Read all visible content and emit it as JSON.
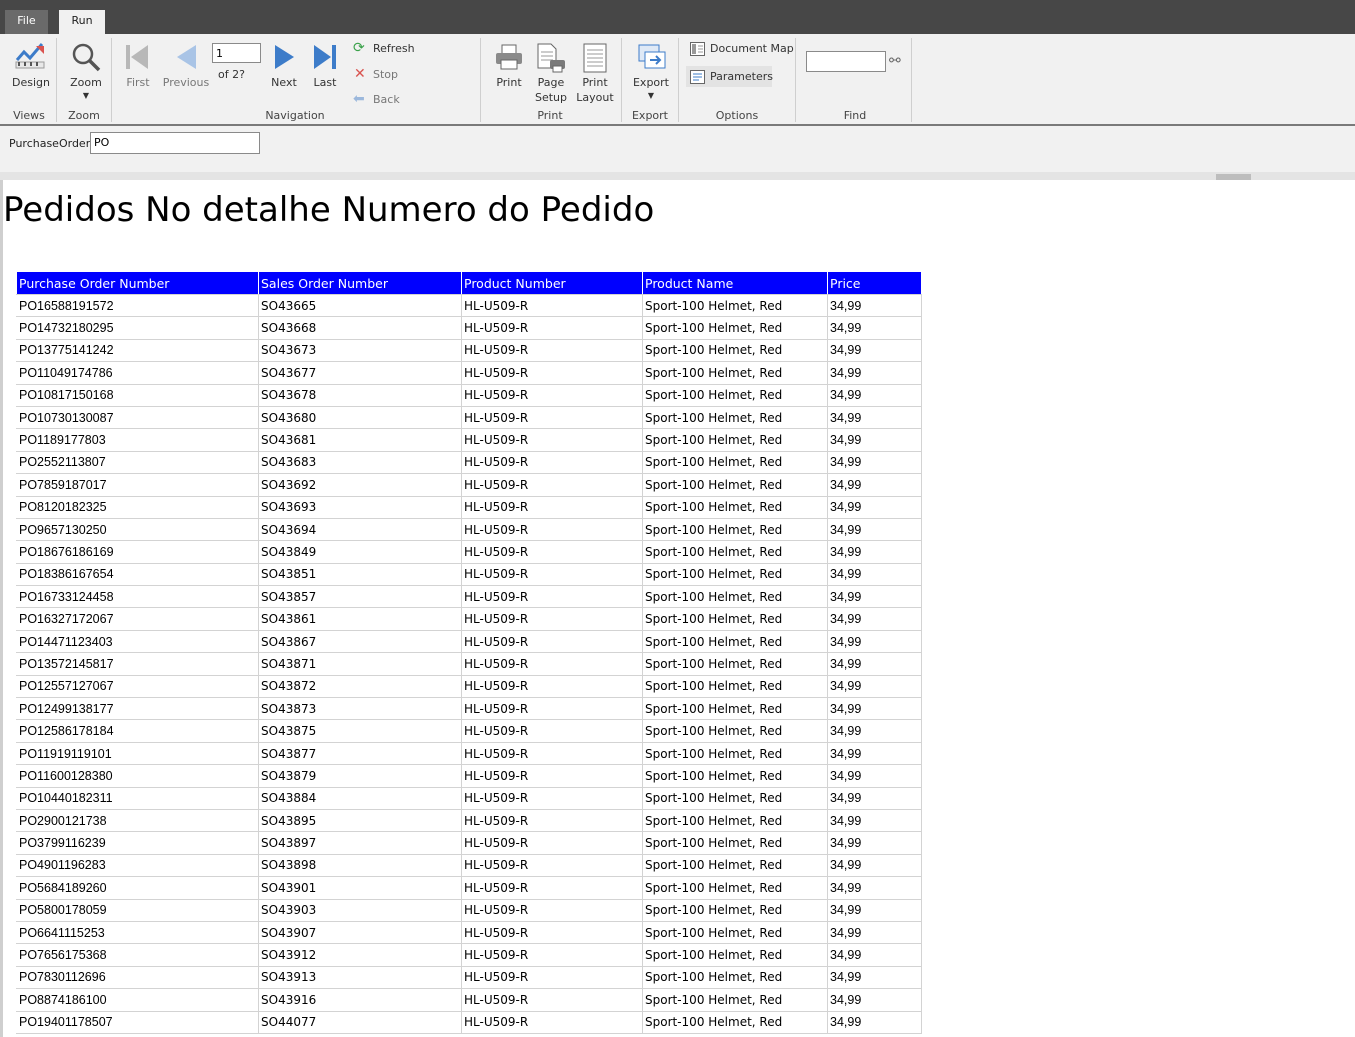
{
  "tabs": {
    "file": "File",
    "run": "Run"
  },
  "ribbon": {
    "views": {
      "design": "Design",
      "group": "Views"
    },
    "zoom": {
      "zoom": "Zoom",
      "group": "Zoom"
    },
    "navigation": {
      "first": "First",
      "previous": "Previous",
      "page_value": "1",
      "of_text": "of  2?",
      "next": "Next",
      "last": "Last",
      "refresh": "Refresh",
      "stop": "Stop",
      "back": "Back",
      "group": "Navigation"
    },
    "print": {
      "print": "Print",
      "page_setup_1": "Page",
      "page_setup_2": "Setup",
      "print_layout_1": "Print",
      "print_layout_2": "Layout",
      "group": "Print"
    },
    "export": {
      "export": "Export",
      "group": "Export"
    },
    "options": {
      "document_map": "Document Map",
      "parameters": "Parameters",
      "group": "Options"
    },
    "find": {
      "value": "",
      "group": "Find"
    }
  },
  "parameters": {
    "label": "PurchaseOrder",
    "value": "PO"
  },
  "report": {
    "title": "Pedidos No detalhe Numero do Pedido",
    "columns": [
      "Purchase Order Number",
      "Sales Order Number",
      "Product Number",
      "Product Name",
      "Price"
    ],
    "rows": [
      [
        "PO16588191572",
        "SO43665",
        "HL-U509-R",
        "Sport-100 Helmet, Red",
        "34,99"
      ],
      [
        "PO14732180295",
        "SO43668",
        "HL-U509-R",
        "Sport-100 Helmet, Red",
        "34,99"
      ],
      [
        "PO13775141242",
        "SO43673",
        "HL-U509-R",
        "Sport-100 Helmet, Red",
        "34,99"
      ],
      [
        "PO11049174786",
        "SO43677",
        "HL-U509-R",
        "Sport-100 Helmet, Red",
        "34,99"
      ],
      [
        "PO10817150168",
        "SO43678",
        "HL-U509-R",
        "Sport-100 Helmet, Red",
        "34,99"
      ],
      [
        "PO10730130087",
        "SO43680",
        "HL-U509-R",
        "Sport-100 Helmet, Red",
        "34,99"
      ],
      [
        "PO1189177803",
        "SO43681",
        "HL-U509-R",
        "Sport-100 Helmet, Red",
        "34,99"
      ],
      [
        "PO2552113807",
        "SO43683",
        "HL-U509-R",
        "Sport-100 Helmet, Red",
        "34,99"
      ],
      [
        "PO7859187017",
        "SO43692",
        "HL-U509-R",
        "Sport-100 Helmet, Red",
        "34,99"
      ],
      [
        "PO8120182325",
        "SO43693",
        "HL-U509-R",
        "Sport-100 Helmet, Red",
        "34,99"
      ],
      [
        "PO9657130250",
        "SO43694",
        "HL-U509-R",
        "Sport-100 Helmet, Red",
        "34,99"
      ],
      [
        "PO18676186169",
        "SO43849",
        "HL-U509-R",
        "Sport-100 Helmet, Red",
        "34,99"
      ],
      [
        "PO18386167654",
        "SO43851",
        "HL-U509-R",
        "Sport-100 Helmet, Red",
        "34,99"
      ],
      [
        "PO16733124458",
        "SO43857",
        "HL-U509-R",
        "Sport-100 Helmet, Red",
        "34,99"
      ],
      [
        "PO16327172067",
        "SO43861",
        "HL-U509-R",
        "Sport-100 Helmet, Red",
        "34,99"
      ],
      [
        "PO14471123403",
        "SO43867",
        "HL-U509-R",
        "Sport-100 Helmet, Red",
        "34,99"
      ],
      [
        "PO13572145817",
        "SO43871",
        "HL-U509-R",
        "Sport-100 Helmet, Red",
        "34,99"
      ],
      [
        "PO12557127067",
        "SO43872",
        "HL-U509-R",
        "Sport-100 Helmet, Red",
        "34,99"
      ],
      [
        "PO12499138177",
        "SO43873",
        "HL-U509-R",
        "Sport-100 Helmet, Red",
        "34,99"
      ],
      [
        "PO12586178184",
        "SO43875",
        "HL-U509-R",
        "Sport-100 Helmet, Red",
        "34,99"
      ],
      [
        "PO11919119101",
        "SO43877",
        "HL-U509-R",
        "Sport-100 Helmet, Red",
        "34,99"
      ],
      [
        "PO11600128380",
        "SO43879",
        "HL-U509-R",
        "Sport-100 Helmet, Red",
        "34,99"
      ],
      [
        "PO10440182311",
        "SO43884",
        "HL-U509-R",
        "Sport-100 Helmet, Red",
        "34,99"
      ],
      [
        "PO2900121738",
        "SO43895",
        "HL-U509-R",
        "Sport-100 Helmet, Red",
        "34,99"
      ],
      [
        "PO3799116239",
        "SO43897",
        "HL-U509-R",
        "Sport-100 Helmet, Red",
        "34,99"
      ],
      [
        "PO4901196283",
        "SO43898",
        "HL-U509-R",
        "Sport-100 Helmet, Red",
        "34,99"
      ],
      [
        "PO5684189260",
        "SO43901",
        "HL-U509-R",
        "Sport-100 Helmet, Red",
        "34,99"
      ],
      [
        "PO5800178059",
        "SO43903",
        "HL-U509-R",
        "Sport-100 Helmet, Red",
        "34,99"
      ],
      [
        "PO6641115253",
        "SO43907",
        "HL-U509-R",
        "Sport-100 Helmet, Red",
        "34,99"
      ],
      [
        "PO7656175368",
        "SO43912",
        "HL-U509-R",
        "Sport-100 Helmet, Red",
        "34,99"
      ],
      [
        "PO7830112696",
        "SO43913",
        "HL-U509-R",
        "Sport-100 Helmet, Red",
        "34,99"
      ],
      [
        "PO8874186100",
        "SO43916",
        "HL-U509-R",
        "Sport-100 Helmet, Red",
        "34,99"
      ],
      [
        "PO19401178507",
        "SO44077",
        "HL-U509-R",
        "Sport-100 Helmet, Red",
        "34,99"
      ]
    ]
  },
  "colors": {
    "header_bg": "#0000ff",
    "header_text": "#ffffff",
    "titlebar": "#474747",
    "ribbon": "#f1f1f1",
    "icon_blue": "#3d7cc9"
  }
}
